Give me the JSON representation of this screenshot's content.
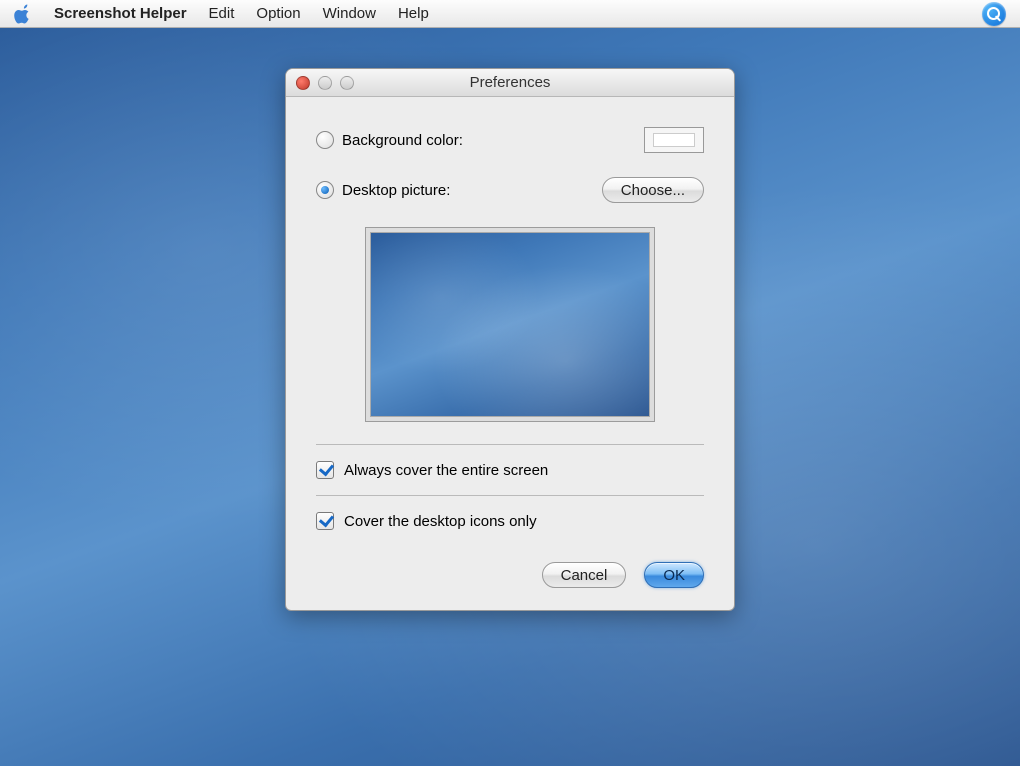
{
  "menubar": {
    "app_name": "Screenshot Helper",
    "items": [
      "Edit",
      "Option",
      "Window",
      "Help"
    ]
  },
  "window": {
    "title": "Preferences"
  },
  "prefs": {
    "background_color_label": "Background color:",
    "background_color_value": "#ffffff",
    "desktop_picture_label": "Desktop picture:",
    "choose_label": "Choose...",
    "selected_option": "desktop_picture",
    "checkbox1_label": "Always cover the entire screen",
    "checkbox1_checked": true,
    "checkbox2_label": "Cover the desktop icons only",
    "checkbox2_checked": true,
    "cancel_label": "Cancel",
    "ok_label": "OK"
  }
}
